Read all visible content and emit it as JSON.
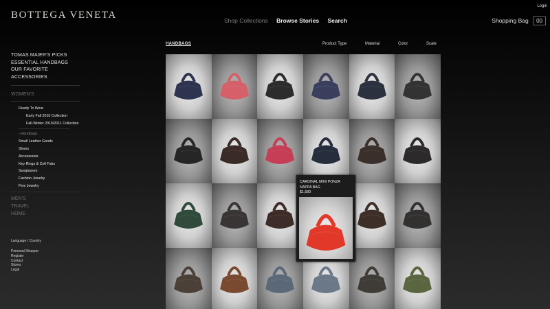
{
  "brand": {
    "logo": "BOTTEGA VENETA"
  },
  "topnav": {
    "shop_collections": "Shop Collections",
    "browse_stories": "Browse Stories",
    "search": "Search"
  },
  "account": {
    "login": "Login",
    "shopping_bag": "Shopping Bag",
    "bag_count": "00"
  },
  "sidebar": {
    "picks": [
      "TOMAS MAIER'S PICKS",
      "ESSENTIAL HANDBAGS",
      "OUR FAVORITE ACCESSORIES"
    ],
    "womens": "WOMEN'S",
    "ready_to_wear": "Ready To Wear",
    "rtw_items": [
      "Early Fall 2010 Collection",
      "Fall-Winter 2010/2011 Collection"
    ],
    "handbags": "› Handbags",
    "categories": [
      "Small Leather Goods",
      "Shoes",
      "Accessories",
      "Key Rings & Cell Fobs",
      "Sunglasses",
      "Fashion Jewelry",
      "Fine Jewelry"
    ],
    "mens": "MEN'S",
    "travel": "TRAVEL",
    "home": "HOME",
    "language": "Language / Country",
    "footer_links": [
      "Personal Shopper",
      "Register",
      "Contact",
      "Stores",
      "Legal"
    ]
  },
  "content": {
    "breadcrumb": "HANDBAGS",
    "filters": [
      "Product Type",
      "Material",
      "Color",
      "Scale"
    ]
  },
  "products": {
    "colors": [
      [
        "#2e3450",
        "#d5606a",
        "#2c2c2c",
        "#3a3f5e",
        "#2c3140",
        "#333333"
      ],
      [
        "#262626",
        "#3a2b26",
        "#c63d56",
        "#262d3d",
        "#3a2f2b",
        "#2c2a2a"
      ],
      [
        "#304a3c",
        "#3a3535",
        "#3d2c28",
        "#3a3232",
        "#3d2e28",
        "#333030"
      ],
      [
        "#4a4038",
        "#7a4a30",
        "#5a6878",
        "#6a7888",
        "#3f3b36",
        "#5a6640"
      ]
    ],
    "hover": {
      "name_line1": "CARDINAL MINI PONZA",
      "name_line2": "NAPPA BAG",
      "price": "$1,580",
      "color": "#e2382a"
    }
  }
}
